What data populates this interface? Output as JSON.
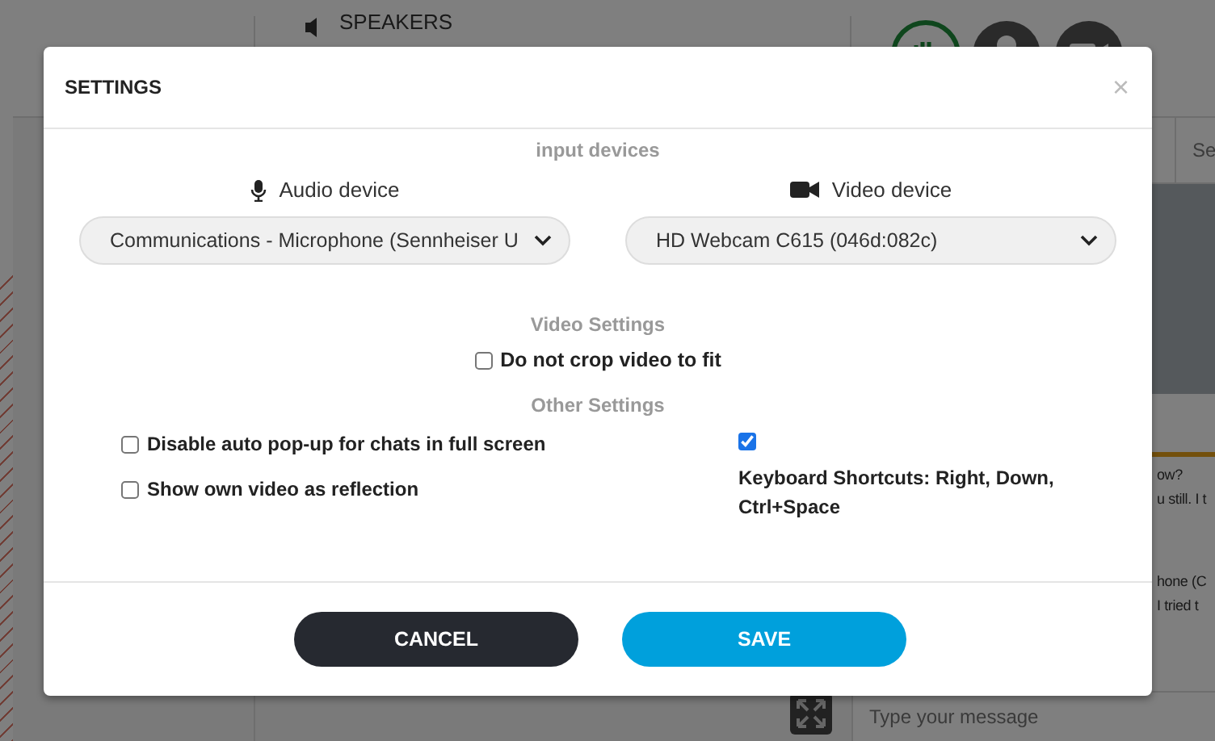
{
  "background": {
    "speakers_label": "SPEAKERS",
    "search_tab": "Se",
    "chat_lines": [
      "ow?",
      "u still. I t",
      "hone (C",
      "I tried t"
    ],
    "message_field": {
      "placeholder": "Type your message"
    }
  },
  "dialog": {
    "title": "SETTINGS",
    "close": "×",
    "devices": {
      "heading": "input devices",
      "selects": [
        {
          "kind": "audio",
          "label": "Audio device",
          "value": "Communications - Microphone (Sennheiser U"
        },
        {
          "kind": "video",
          "label": "Video device",
          "value": "HD Webcam C615 (046d:082c)"
        }
      ]
    },
    "video_settings": {
      "heading": "Video Settings",
      "options": [
        {
          "label": "Do not crop video to fit",
          "checked": false
        }
      ]
    },
    "other_settings": {
      "heading": "Other Settings",
      "left_options": [
        {
          "label": "Disable auto pop-up for chats in full screen",
          "checked": false
        },
        {
          "label": "Show own video as reflection",
          "checked": false
        }
      ],
      "right_options": [
        {
          "label": "Keyboard Shortcuts: Right, Down, Ctrl+Space",
          "checked": true
        }
      ]
    },
    "buttons": [
      {
        "kind": "cancel",
        "label": "CANCEL"
      },
      {
        "kind": "save",
        "label": "SAVE"
      }
    ]
  }
}
